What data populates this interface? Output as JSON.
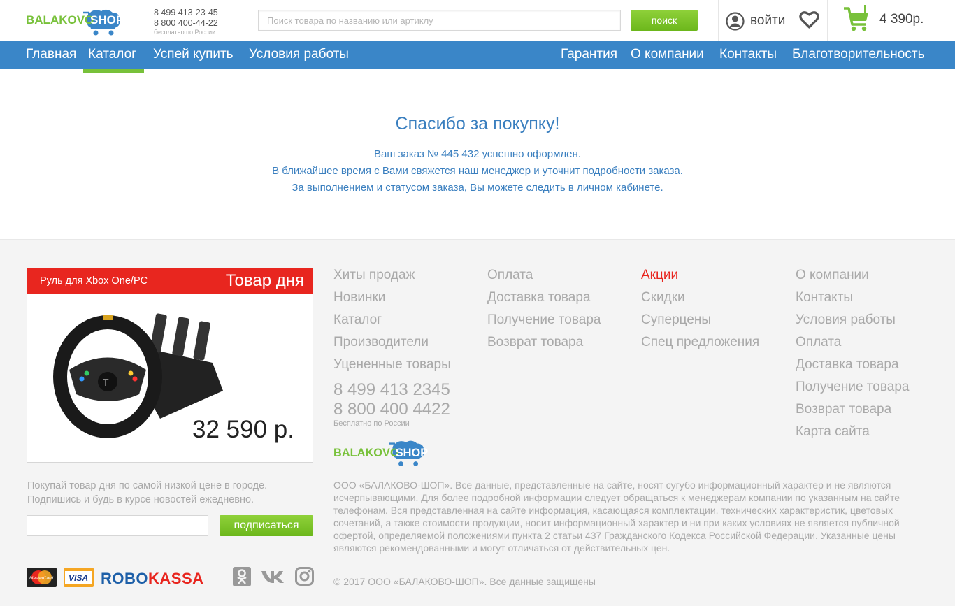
{
  "header": {
    "logo": {
      "part1": "BALAKOVO",
      "part2": "SHOP"
    },
    "phone1": "8 499 413-23-45",
    "phone2": "8 800 400-44-22",
    "phone_note": "бесплатно по России",
    "search_placeholder": "Поиск товара по названию или артиклу",
    "search_button": "поиск",
    "login_label": "войти",
    "cart_total": "4 390р.",
    "icons": [
      "user-icon",
      "heart-icon",
      "cart-icon"
    ]
  },
  "nav": {
    "left": [
      "Главная",
      "Каталог",
      "Успей купить",
      "Условия работы"
    ],
    "right": [
      "Гарантия",
      "О компании",
      "Контакты",
      "Благотворительность"
    ],
    "active": "Каталог"
  },
  "confirmation": {
    "title": "Спасибо за покупку!",
    "line1": "Ваш заказ № 445 432 успешно оформлен.",
    "line2": "В ближайшее время с Вами свяжется наш менеджер и уточнит подробности заказа.",
    "line3": "За выполнением и статусом заказа, Вы можете следить в личном кабинете."
  },
  "deal": {
    "name": "Руль для Xbox One/PC",
    "label": "Товар дня",
    "price": "32 590 р."
  },
  "footer": {
    "col1": [
      "Хиты продаж",
      "Новинки",
      "Каталог",
      "Производители",
      "Уцененные товары"
    ],
    "col2": [
      "Оплата",
      "Доставка товара",
      "Получение товара",
      "Возврат товара"
    ],
    "col3": [
      "Акции",
      "Скидки",
      "Суперцены",
      "Спец предложения"
    ],
    "col4": [
      "О компании",
      "Контакты",
      "Условия работы",
      "Оплата",
      "Доставка товара",
      "Получение товара",
      "Возврат товара",
      "Карта сайта"
    ],
    "phone1": "8 499 413 2345",
    "phone2": "8 800 400 4422",
    "phone_note": "Бесплатно по России",
    "promo_line1": "Покупай товар дня по самой низкой цене в городе.",
    "promo_line2": "Подпишись и будь в курсе новостей ежедневно.",
    "subscribe_button": "подписаться",
    "legal": "ООО «БАЛАКОВО-ШОП». Все данные, представленные на сайте, носят сугубо информационный характер и не являются исчерпывающими. Для более подробной информации следует обращаться к менеджерам компании по указанным на сайте телефонам. Вся представленная на сайте информация, касающаяся комплектации, технических характеристик, цветовых сочетаний, а также стоимости продукции, носит информационный характер и ни при каких условиях не является публичной офертой, определяемой положениями пункта 2 статьи 437 Гражданского Кодекса Российской Федерации. Указанные цены являются рекомендованными и могут отличаться от действительных цен.",
    "copyright": "© 2017 ООО «БАЛАКОВО-ШОП». Все данные защищены",
    "payments": {
      "mastercard": "MasterCard",
      "visa": "VISA",
      "robo1": "ROBO",
      "robo2": "KASSA"
    },
    "social_icons": [
      "odnoklassniki-icon",
      "vk-icon",
      "instagram-icon"
    ]
  },
  "colors": {
    "blue": "#3a86c8",
    "green": "#78c13a",
    "red": "#e8261f",
    "text_blue": "#3a7fbf"
  }
}
